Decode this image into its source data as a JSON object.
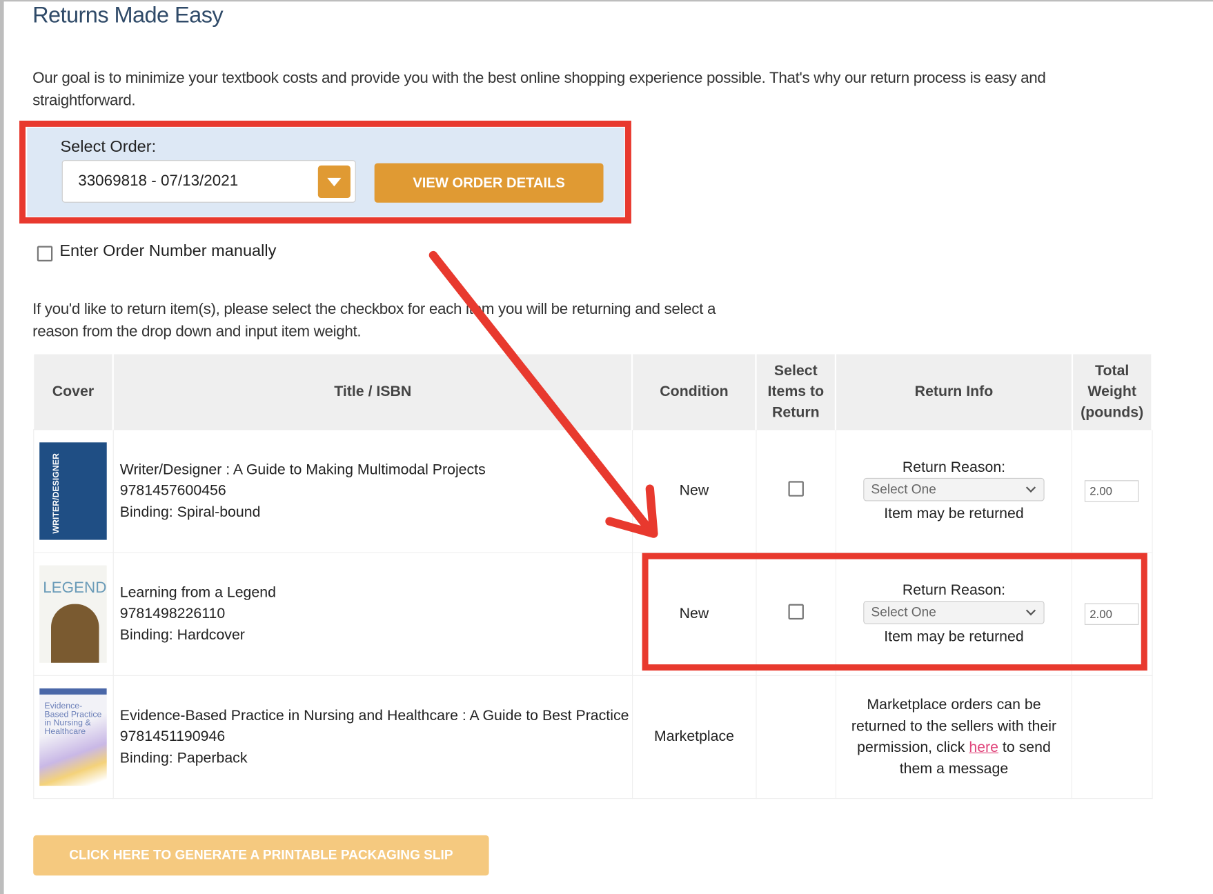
{
  "page": {
    "title": "Returns Made Easy",
    "intro": "Our goal is to minimize your textbook costs and provide you with the best online shopping experience possible. That's why our return process is easy and straightforward."
  },
  "order_selector": {
    "label": "Select Order:",
    "selected_value": "33069818 - 07/13/2021",
    "view_button": "VIEW ORDER DETAILS",
    "manual_checkbox_label": "Enter Order Number manually",
    "manual_checked": false
  },
  "instructions": "If you'd like to return item(s), please select the checkbox for each item you will be returning and select a reason from the drop down and input item weight.",
  "table": {
    "headers": [
      "Cover",
      "Title / ISBN",
      "Condition",
      "Select Items to Return",
      "Return Info",
      "Total Weight (pounds)"
    ],
    "rows": [
      {
        "title": "Writer/Designer : A Guide to Making Multimodal Projects",
        "isbn": "9781457600456",
        "binding": "Binding: Spiral-bound",
        "cover_text": "WRITER/DESIGNER",
        "condition": "New",
        "return_reason_label": "Return Reason:",
        "return_reason_value": "Select One",
        "status": "Item may be returned",
        "weight": "2.00"
      },
      {
        "title": "Learning from a Legend",
        "isbn": "9781498226110",
        "binding": "Binding: Hardcover",
        "cover_text": "LEGEND",
        "condition": "New",
        "return_reason_label": "Return Reason:",
        "return_reason_value": "Select One",
        "status": "Item may be returned",
        "weight": "2.00"
      },
      {
        "title": "Evidence-Based Practice in Nursing and Healthcare : A Guide to Best Practice",
        "isbn": "9781451190946",
        "binding": "Binding: Paperback",
        "cover_text": "Evidence-Based Practice in Nursing & Healthcare",
        "condition": "Marketplace",
        "info_before": "Marketplace orders can be returned to the sellers with their permission, click ",
        "info_link": "here",
        "info_after": " to send them a message"
      }
    ]
  },
  "slip_button": "CLICK HERE TO GENERATE A PRINTABLE PACKAGING SLIP",
  "colors": {
    "accent_orange": "#e09a33",
    "annotation_red": "#e8392e",
    "panel_blue": "#dde8f5",
    "link_pink": "#e0457b"
  }
}
